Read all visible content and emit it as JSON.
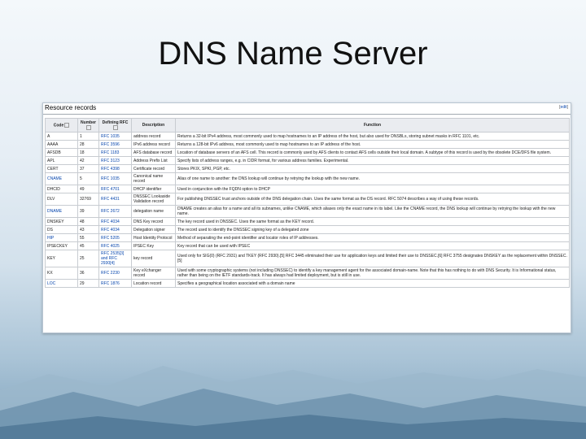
{
  "slide": {
    "title": "DNS Name Server"
  },
  "panel": {
    "heading": "Resource records",
    "edit_label": "edit"
  },
  "table": {
    "headers": [
      "Code",
      "Number",
      "Defining RFC",
      "Description",
      "Function"
    ],
    "rows": [
      {
        "code": "A",
        "code_link": false,
        "number": "1",
        "rfc": "RFC 1035",
        "desc": "address record",
        "func": "Returns a 32-bit IPv4 address, most commonly used to map hostnames to an IP address of the host, but also used for DNSBLs, storing subnet masks in RFC 1101, etc."
      },
      {
        "code": "AAAA",
        "code_link": false,
        "number": "28",
        "rfc": "RFC 3596",
        "desc": "IPv6 address record",
        "func": "Returns a 128-bit IPv6 address, most commonly used to map hostnames to an IP address of the host."
      },
      {
        "code": "AFSDB",
        "code_link": false,
        "number": "18",
        "rfc": "RFC 1183",
        "desc": "AFS database record",
        "func": "Location of database servers of an AFS cell. This record is commonly used by AFS clients to contact AFS cells outside their local domain. A subtype of this record is used by the obsolete DCE/DFS file system."
      },
      {
        "code": "APL",
        "code_link": false,
        "number": "42",
        "rfc": "RFC 3123",
        "desc": "Address Prefix List",
        "func": "Specify lists of address ranges, e.g. in CIDR format, for various address families. Experimental."
      },
      {
        "code": "CERT",
        "code_link": false,
        "number": "37",
        "rfc": "RFC 4398",
        "desc": "Certificate record",
        "func": "Stores PKIX, SPKI, PGP, etc."
      },
      {
        "code": "CNAME",
        "code_link": true,
        "number": "5",
        "rfc": "RFC 1035",
        "desc": "Canonical name record",
        "func": "Alias of one name to another: the DNS lookup will continue by retrying the lookup with the new name."
      },
      {
        "code": "DHCID",
        "code_link": false,
        "number": "49",
        "rfc": "RFC 4701",
        "desc": "DHCP identifier",
        "func": "Used in conjunction with the FQDN option to DHCP"
      },
      {
        "code": "DLV",
        "code_link": false,
        "number": "32769",
        "rfc": "RFC 4431",
        "desc": "DNSSEC Lookaside Validation record",
        "func": "For publishing DNSSEC trust anchors outside of the DNS delegation chain. Uses the same format as the DS record. RFC 5074 describes a way of using these records."
      },
      {
        "code": "DNAME",
        "code_link": true,
        "number": "39",
        "rfc": "RFC 2672",
        "desc": "delegation name",
        "func": "DNAME creates an alias for a name and all its subnames, unlike CNAME, which aliases only the exact name in its label. Like the CNAME record, the DNS lookup will continue by retrying the lookup with the new name."
      },
      {
        "code": "DNSKEY",
        "code_link": false,
        "number": "48",
        "rfc": "RFC 4034",
        "desc": "DNS Key record",
        "func": "The key record used in DNSSEC. Uses the same format as the KEY record."
      },
      {
        "code": "DS",
        "code_link": false,
        "number": "43",
        "rfc": "RFC 4034",
        "desc": "Delegation signer",
        "func": "The record used to identify the DNSSEC signing key of a delegated zone"
      },
      {
        "code": "HIP",
        "code_link": true,
        "number": "55",
        "rfc": "RFC 5205",
        "desc": "Host Identity Protocol",
        "func": "Method of separating the end-point identifier and locator roles of IP addresses."
      },
      {
        "code": "IPSECKEY",
        "code_link": false,
        "number": "45",
        "rfc": "RFC 4025",
        "desc": "IPSEC Key",
        "func": "Key record that can be used with IPSEC"
      },
      {
        "code": "KEY",
        "code_link": false,
        "number": "25",
        "rfc": "RFC 2535[3] and RFC 2930[4]",
        "desc": "key record",
        "func": "Used only for SIG(0) (RFC 2931) and TKEY (RFC 2930).[5] RFC 3445 eliminated their use for application keys and limited their use to DNSSEC.[6] RFC 3755 designates DNSKEY as the replacement within DNSSEC.[5]"
      },
      {
        "code": "KX",
        "code_link": false,
        "number": "36",
        "rfc": "RFC 2230",
        "desc": "Key eXchanger record",
        "func": "Used with some cryptographic systems (not including DNSSEC) to identify a key management agent for the associated domain-name. Note that this has nothing to do with DNS Security. It is Informational status, rather than being on the IETF standards-track. It has always had limited deployment, but is still in use."
      },
      {
        "code": "LOC",
        "code_link": true,
        "number": "29",
        "rfc": "RFC 1876",
        "desc": "Location record",
        "func": "Specifies a geographical location associated with a domain name"
      }
    ]
  }
}
